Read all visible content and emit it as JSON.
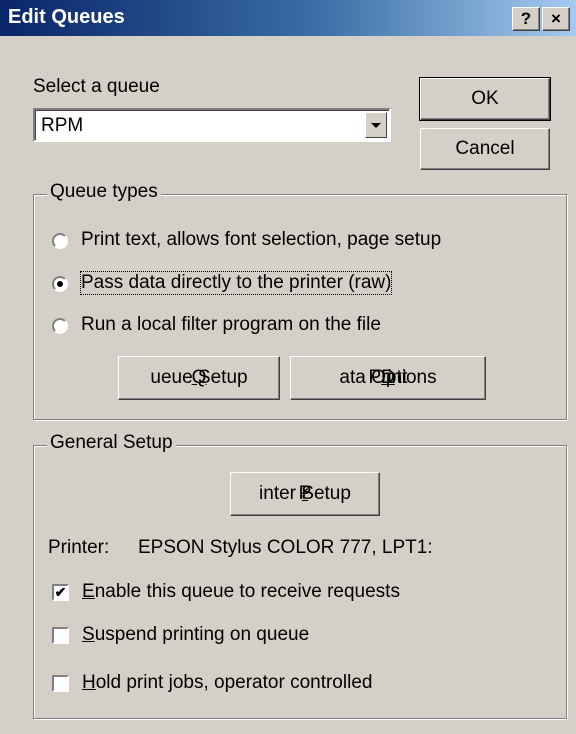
{
  "window": {
    "title": "Edit Queues",
    "help_glyph": "?",
    "close_glyph": "×"
  },
  "queue_select": {
    "label": "Select a queue",
    "value": "RPM"
  },
  "buttons": {
    "ok": "OK",
    "cancel": "Cancel"
  },
  "queue_types": {
    "legend": "Queue types",
    "options": [
      {
        "label": "Print text, allows font selection, page setup",
        "selected": false
      },
      {
        "label": "Pass data directly to the printer (raw)",
        "selected": true
      },
      {
        "label": "Run a local filter program on the file",
        "selected": false
      }
    ],
    "queue_setup": {
      "pre": "",
      "accel": "Q",
      "post": "ueue Setup"
    },
    "print_data_options": {
      "pre": "Print ",
      "accel": "D",
      "post": "ata Options"
    }
  },
  "general_setup": {
    "legend": "General Setup",
    "printer_setup": {
      "pre": "P",
      "accel": "r",
      "post": "inter Setup"
    },
    "printer_label": "Printer:",
    "printer_value": "EPSON Stylus COLOR 777, LPT1:",
    "checks": [
      {
        "accel": "E",
        "rest": "nable this queue to receive requests",
        "checked": true
      },
      {
        "accel": "S",
        "rest": "uspend printing on queue",
        "checked": false
      },
      {
        "accel": "H",
        "rest": "old print jobs, operator controlled",
        "checked": false
      }
    ],
    "check_mark": "✔"
  }
}
